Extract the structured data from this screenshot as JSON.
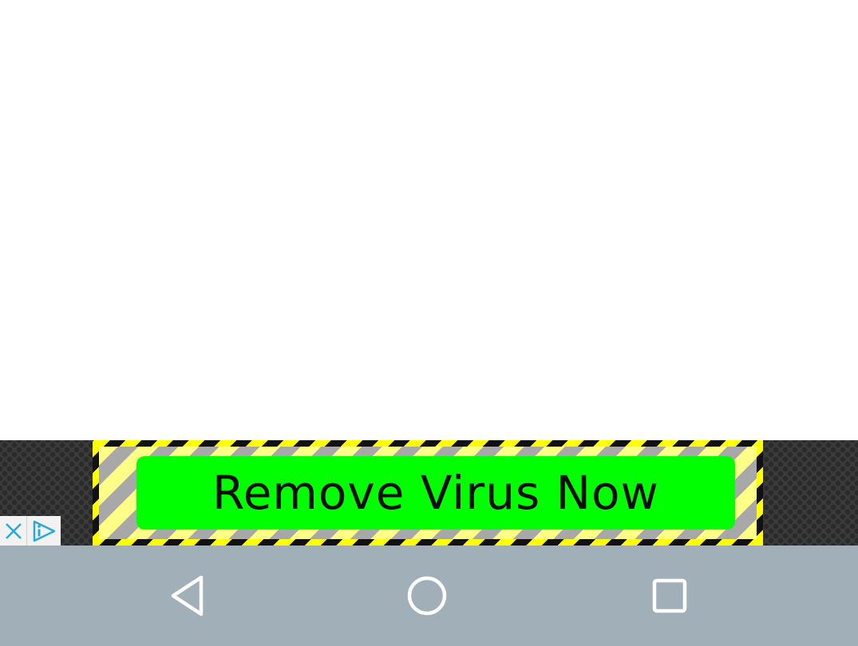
{
  "ad": {
    "button_label": "Remove Virus Now",
    "colors": {
      "button": "#00ff00",
      "stripe_yellow": "#ffff00",
      "stripe_black": "#111111",
      "inner_light": "#ffff88",
      "inner_gray": "#a8a8a8",
      "strip_background": "#3a3a3a",
      "adchoices_blue": "#29a9d9"
    },
    "icons": {
      "close": "close-icon",
      "adchoices": "adchoices-icon"
    }
  },
  "nav_bar": {
    "background": "#a1b0b8",
    "buttons": [
      {
        "name": "back",
        "icon": "back-triangle-icon"
      },
      {
        "name": "home",
        "icon": "home-circle-icon"
      },
      {
        "name": "recents",
        "icon": "recents-square-icon"
      }
    ]
  }
}
